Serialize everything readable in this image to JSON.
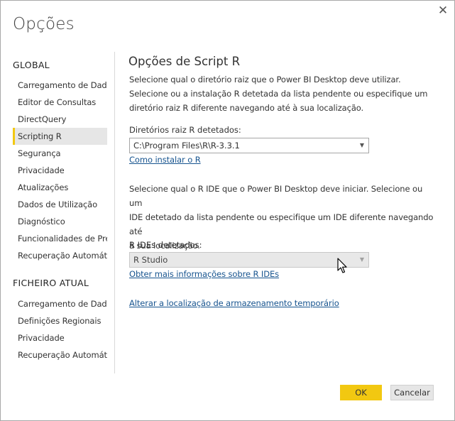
{
  "dialog": {
    "title": "Opções",
    "close_glyph": "✕",
    "close_icon": "close-icon"
  },
  "sidebar": {
    "global_header": "GLOBAL",
    "global_items": [
      {
        "label": "Carregamento de Dados",
        "selected": false
      },
      {
        "label": "Editor de Consultas",
        "selected": false
      },
      {
        "label": "DirectQuery",
        "selected": false
      },
      {
        "label": "Scripting R",
        "selected": true
      },
      {
        "label": "Segurança",
        "selected": false
      },
      {
        "label": "Privacidade",
        "selected": false
      },
      {
        "label": "Atualizações",
        "selected": false
      },
      {
        "label": "Dados de Utilização",
        "selected": false
      },
      {
        "label": "Diagnóstico",
        "selected": false
      },
      {
        "label": "Funcionalidades de Pré...",
        "selected": false
      },
      {
        "label": "Recuperação Automática",
        "selected": false
      }
    ],
    "current_file_header": "FICHEIRO ATUAL",
    "current_file_items": [
      {
        "label": "Carregamento de Dados"
      },
      {
        "label": "Definições Regionais"
      },
      {
        "label": "Privacidade"
      },
      {
        "label": "Recuperação Automática"
      }
    ]
  },
  "main": {
    "title": "Opções de Script R",
    "intro_lines": [
      "Selecione qual o diretório raiz que o Power BI Desktop deve utilizar.",
      "Selecione ou a instalação R detetada da lista pendente ou especifique um",
      "diretório raiz R diferente navegando até à sua localização."
    ],
    "home_dir_label": "Diretórios raiz R detetados:",
    "home_dir_value": "C:\\Program Files\\R\\R-3.3.1",
    "install_link": "Como instalar o R",
    "ide_lines": [
      "Selecione qual o R IDE que o Power BI Desktop deve iniciar. Selecione ou um",
      "IDE detetado da lista pendente ou especifique um IDE diferente navegando até",
      "à sua localização."
    ],
    "ide_label": "R IDEs detetados:",
    "ide_value": "R Studio",
    "ide_info_link": "Obter mais informações sobre R IDEs",
    "temp_storage_link": "Alterar a localização de armazenamento temporário",
    "dropdown_caret": "▼"
  },
  "footer": {
    "ok_label": "OK",
    "cancel_label": "Cancelar"
  },
  "colors": {
    "accent": "#f2c811",
    "link": "#17548f",
    "selected_bg": "#e6e6e6"
  }
}
